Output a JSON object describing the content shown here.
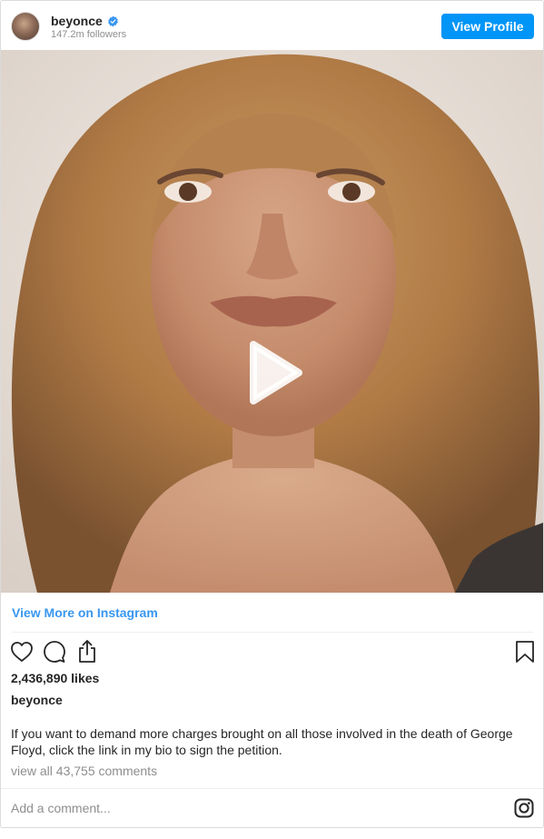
{
  "header": {
    "username": "beyonce",
    "followers": "147.2m followers",
    "view_profile_label": "View Profile"
  },
  "media": {
    "type": "video"
  },
  "view_more_label": "View More on Instagram",
  "actions": {
    "icons": [
      "heart-icon",
      "comment-icon",
      "share-icon",
      "bookmark-icon"
    ]
  },
  "post": {
    "likes": "2,436,890 likes",
    "caption_username": "beyonce",
    "caption_text": "If you want to demand more charges brought on all those involved in the death of George Floyd, click the link in my bio to sign the petition.",
    "comments_link": "view all 43,755 comments"
  },
  "footer": {
    "add_comment_placeholder": "Add a comment...",
    "brand_icon": "instagram-icon"
  },
  "colors": {
    "accent": "#0095f6",
    "link": "#3897f0",
    "muted": "#8e8e8e",
    "text": "#262626",
    "border": "#dbdbdb"
  }
}
